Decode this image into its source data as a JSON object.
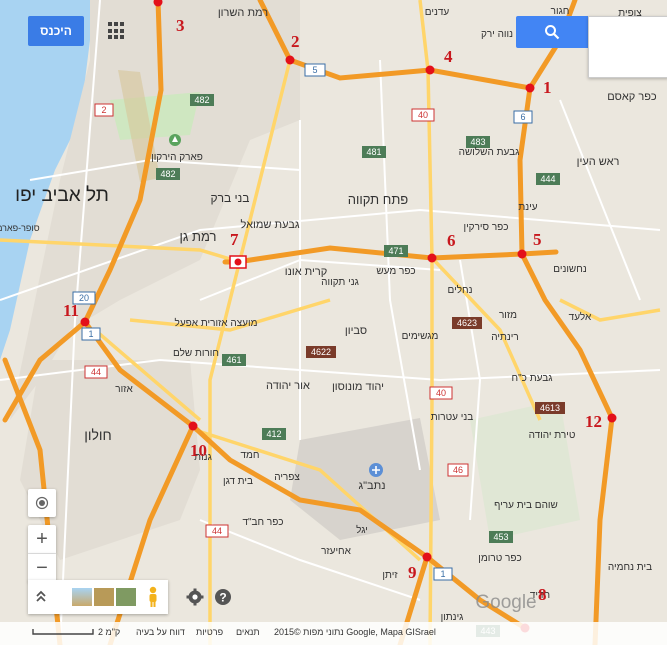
{
  "header": {
    "signin_label": "היכנס",
    "search_placeholder": ""
  },
  "icons": {
    "apps": "apps-grid-icon",
    "search": "search-icon",
    "locate": "my-location-icon",
    "pegman": "street-view-pegman-icon",
    "settings": "gear-icon",
    "help": "help-icon",
    "layers": "expand-layers-icon"
  },
  "zoom": {
    "in_label": "+",
    "out_label": "−"
  },
  "footer": {
    "attribution": "נתוני מפות ©2015 Google, Mapa GISrael",
    "terms": "תנאים",
    "privacy": "פרטיות",
    "report": "דווח על בעיה",
    "scale": "2 ק\"מ"
  },
  "watermark": "Google",
  "markers": [
    {
      "number": "1"
    },
    {
      "number": "2"
    },
    {
      "number": "3"
    },
    {
      "number": "4"
    },
    {
      "number": "5"
    },
    {
      "number": "6"
    },
    {
      "number": "7"
    },
    {
      "number": "8"
    },
    {
      "number": "9"
    },
    {
      "number": "10"
    },
    {
      "number": "11"
    },
    {
      "number": "12"
    }
  ],
  "shields": [
    "5",
    "482",
    "482",
    "2",
    "40",
    "483",
    "481",
    "6",
    "444",
    "471",
    "20",
    "1",
    "44",
    "461",
    "4622",
    "4623",
    "40",
    "412",
    "4613",
    "46",
    "44",
    "1",
    "453",
    "443"
  ],
  "places": {
    "tel_aviv": "תל אביב יפו",
    "ramat_gan": "רמת גן",
    "bnei_brak": "בני ברק",
    "petah_tikva": "פתח תקווה",
    "holon": "חולון",
    "ramat_hasharon": "רמת השרון",
    "giv_at_shmuel": "גבעת שמואל",
    "kiryat_ono": "קרית אונו",
    "or_yehuda": "אור יהודה",
    "yehud": "יהוד מונוסון",
    "savyon": "סביון",
    "ganei_tikva": "גני תקווה",
    "kfar_maas": "כפר מעש",
    "kfar_sirkin": "כפר סירקין",
    "rosh_haayin": "ראש העין",
    "kfar_kasem": "כפר קאסם",
    "givat_hashlosha": "גבעת השלושה",
    "nahshonim": "נחשונים",
    "nehalim": "נחלים",
    "mazor": "מזור",
    "rinatia": "רינתיה",
    "el_ad": "אלעד",
    "givat_koach": "גבעת כ\"ח",
    "tirat_yehuda": "טירת יהודה",
    "bnei_atarot": "בני עטרות",
    "migshimim": "מגשימים",
    "shoham": "שוהם בית עריף",
    "kfar_truman": "כפר טרומן",
    "beit_nehemia": "בית נחמיה",
    "hadid": "חדיד",
    "ginaton": "גינתון",
    "natbag": "נתב\"ג",
    "tzafria": "צפריה",
    "kfar_habad": "כפר חב\"ד",
    "yagel": "יגל",
    "ahiezer": "אחיעזר",
    "zeitan": "זיתן",
    "beit_dagan": "בית דגן",
    "hemed": "חמד",
    "ganot": "גנות",
    "azor": "אזור",
    "hurvat_shalom": "חורות שלם",
    "mitzpe": "מועצה אזורית אפעל",
    "park_hayarkon": "פארק הירקון",
    "nave_yarak": "נווה ירק",
    "adanim": "עדנים",
    "hagor": "חגור",
    "tzofit": "צופית",
    "einat": "עינת",
    "sofer_paris": "סופר-פארם"
  }
}
